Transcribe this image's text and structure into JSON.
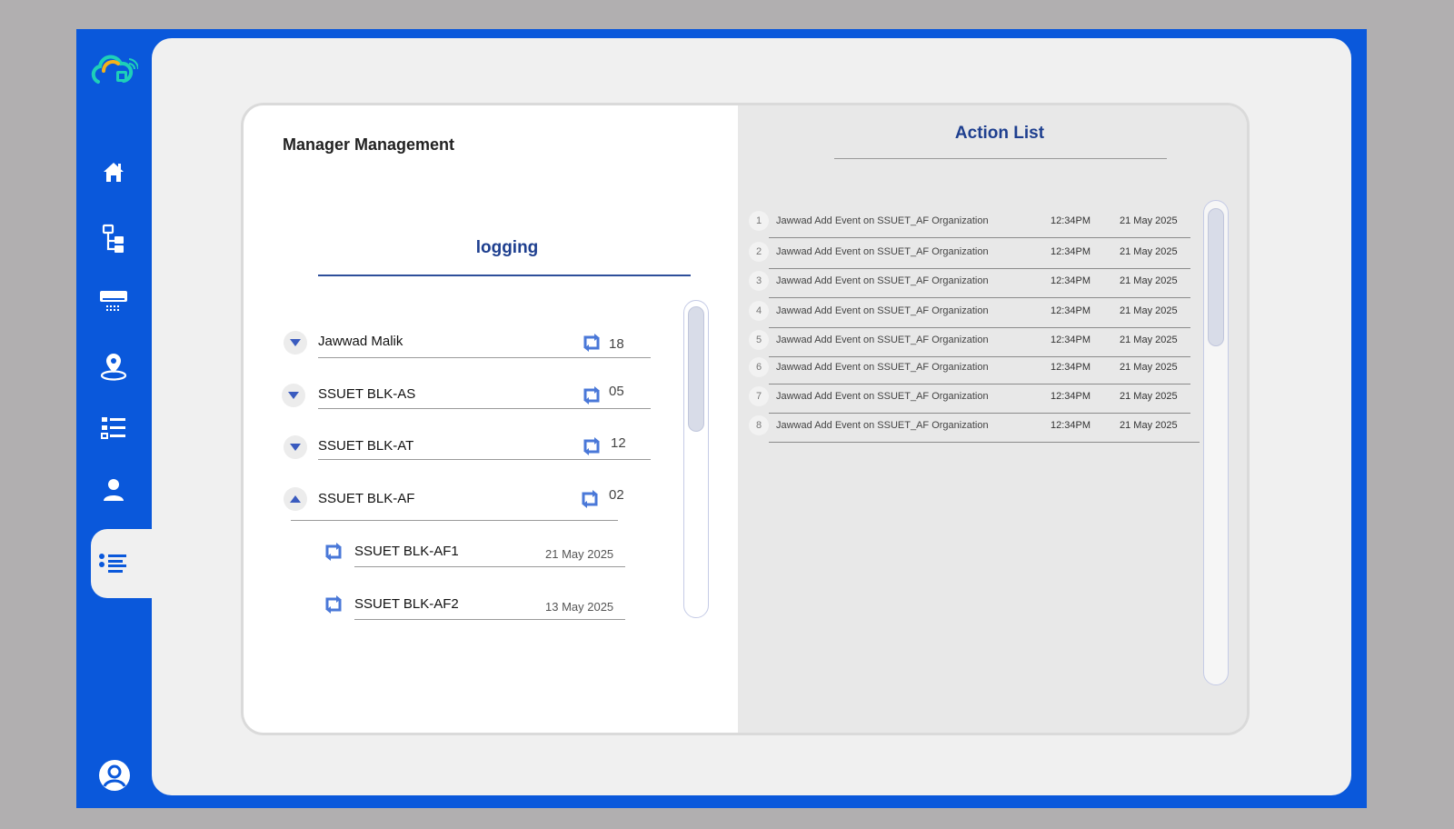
{
  "brand": {
    "accent": "#0a58db",
    "heading_color": "#1e3f8f",
    "icon_color": "#4a78d8"
  },
  "sidebar": {
    "items": [
      {
        "icon": "home-icon"
      },
      {
        "icon": "hierarchy-icon"
      },
      {
        "icon": "air-conditioner-icon"
      },
      {
        "icon": "location-pin-icon"
      },
      {
        "icon": "checklist-icon"
      },
      {
        "icon": "user-icon"
      },
      {
        "icon": "list-icon",
        "active": true
      }
    ],
    "profile_icon": "profile-circle-icon"
  },
  "left": {
    "title": "Manager Management",
    "subtitle": "logging",
    "managers": [
      {
        "name": "Jawwad Malik",
        "count": "18",
        "expanded": false
      },
      {
        "name": "SSUET BLK-AS",
        "count": "05",
        "expanded": false
      },
      {
        "name": "SSUET BLK-AT",
        "count": "12",
        "expanded": false
      },
      {
        "name": "SSUET BLK-AF",
        "count": "02",
        "expanded": true
      }
    ],
    "children": [
      {
        "name": "SSUET BLK-AF1",
        "date": "21 May 2025"
      },
      {
        "name": "SSUET BLK-AF2",
        "date": "13 May 2025"
      }
    ]
  },
  "right": {
    "title": "Action List",
    "actions": [
      {
        "num": "1",
        "text": "Jawwad Add Event on SSUET_AF Organization",
        "time": "12:34PM",
        "date": "21 May 2025"
      },
      {
        "num": "2",
        "text": "Jawwad Add Event on SSUET_AF Organization",
        "time": "12:34PM",
        "date": "21 May 2025"
      },
      {
        "num": "3",
        "text": "Jawwad Add Event on SSUET_AF Organization",
        "time": "12:34PM",
        "date": "21 May 2025"
      },
      {
        "num": "4",
        "text": "Jawwad Add Event on SSUET_AF Organization",
        "time": "12:34PM",
        "date": "21 May 2025"
      },
      {
        "num": "5",
        "text": "Jawwad Add Event on SSUET_AF Organization",
        "time": "12:34PM",
        "date": "21 May 2025"
      },
      {
        "num": "6",
        "text": "Jawwad Add Event on SSUET_AF Organization",
        "time": "12:34PM",
        "date": "21 May 2025"
      },
      {
        "num": "7",
        "text": "Jawwad Add Event on SSUET_AF Organization",
        "time": "12:34PM",
        "date": "21 May 2025"
      },
      {
        "num": "8",
        "text": "Jawwad Add Event on SSUET_AF Organization",
        "time": "12:34PM",
        "date": "21 May 2025"
      }
    ]
  }
}
